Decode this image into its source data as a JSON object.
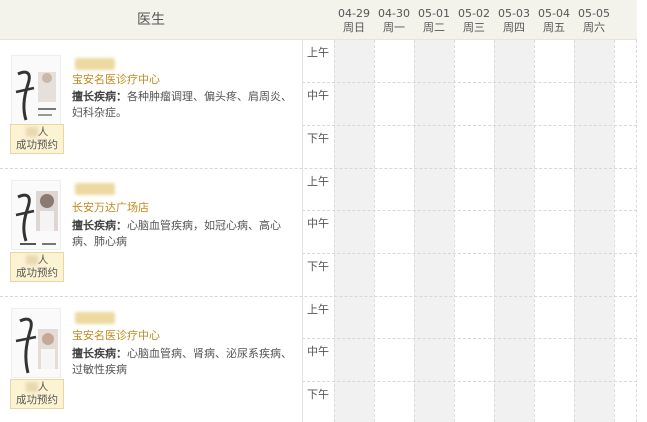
{
  "header": {
    "doctor_col": "医生",
    "days": [
      {
        "date": "04-29",
        "weekday": "周日"
      },
      {
        "date": "04-30",
        "weekday": "周一"
      },
      {
        "date": "05-01",
        "weekday": "周二"
      },
      {
        "date": "05-02",
        "weekday": "周三"
      },
      {
        "date": "05-03",
        "weekday": "周四"
      },
      {
        "date": "05-04",
        "weekday": "周五"
      },
      {
        "date": "05-05",
        "weekday": "周六"
      }
    ]
  },
  "periods": {
    "morning": "上午",
    "noon": "中午",
    "afternoon": "下午"
  },
  "spec_label": "擅长疾病：",
  "badge_unit": "人",
  "badge_label": "成功预约",
  "doctors": [
    {
      "hospital": "宝安名医诊疗中心",
      "specialty_line1": "各种肿瘤调理、偏头疼、肩周炎、",
      "specialty_line2": "妇科杂症。"
    },
    {
      "hospital": "长安万达广场店",
      "specialty_line1": "心脑血管疾病，如冠心病、高心",
      "specialty_line2": "病、肺心病"
    },
    {
      "hospital": "宝安名医诊疗中心",
      "specialty_line1": "心脑血管病、肾病、泌尿系疾病、",
      "specialty_line2": "过敏性疾病"
    }
  ],
  "colors": {
    "accent": "#c08a1e",
    "header_bg": "#f3f3ec",
    "badge_bg": "#fcf3d2",
    "grid_gray": "#f1f1f1"
  }
}
